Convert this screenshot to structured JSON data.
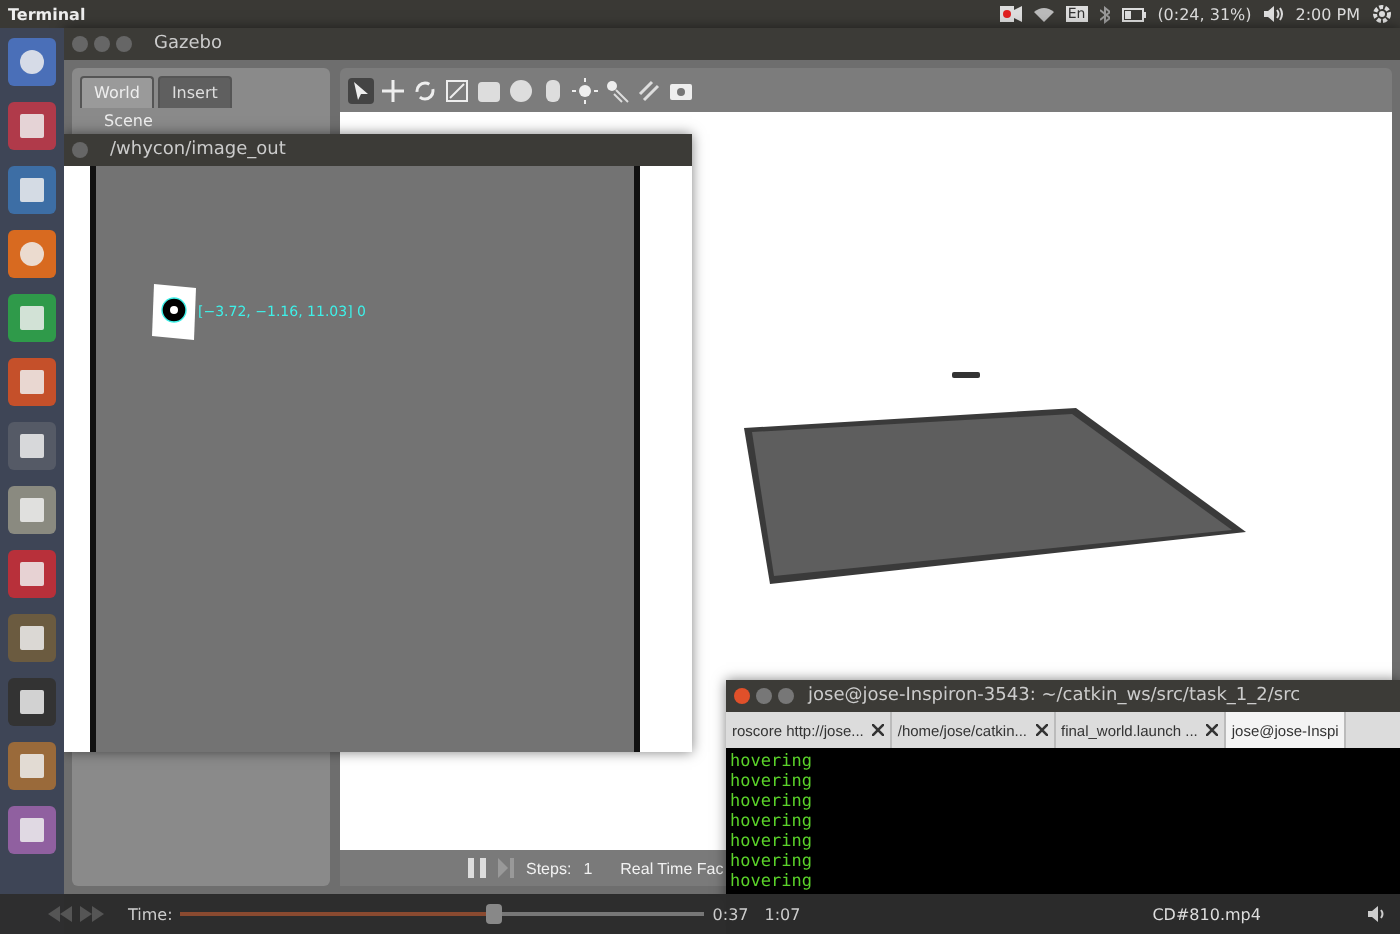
{
  "top_bar": {
    "title": "Terminal",
    "keyboard": "En",
    "battery": "(0:24, 31%)",
    "clock": "2:00 PM"
  },
  "gazebo": {
    "title": "Gazebo",
    "tabs": [
      {
        "label": "World",
        "selected": true
      },
      {
        "label": "Insert",
        "selected": false
      }
    ],
    "tree_items": [
      "Scene"
    ],
    "steps_label": "Steps:",
    "steps_value": "1",
    "real_time": "Real Time Fac"
  },
  "image_window": {
    "title": "/whycon/image_out",
    "marker_label": "[−3.72, −1.16, 11.03] 0"
  },
  "terminal": {
    "title": "jose@jose-Inspiron-3543: ~/catkin_ws/src/task_1_2/src",
    "tabs": [
      {
        "label": "roscore http://jose...",
        "selected": false,
        "closable": true
      },
      {
        "label": "/home/jose/catkin...",
        "selected": false,
        "closable": true
      },
      {
        "label": "final_world.launch ...",
        "selected": false,
        "closable": true
      },
      {
        "label": "jose@jose-Inspi",
        "selected": true,
        "closable": false
      }
    ],
    "lines": [
      "hovering",
      "hovering",
      "hovering",
      "hovering",
      "hovering",
      "hovering",
      "hovering"
    ]
  },
  "player": {
    "time_label": "Time:",
    "elapsed": "0:37",
    "duration": "1:07",
    "file": "CD#810.mp4",
    "level": 0.6
  }
}
